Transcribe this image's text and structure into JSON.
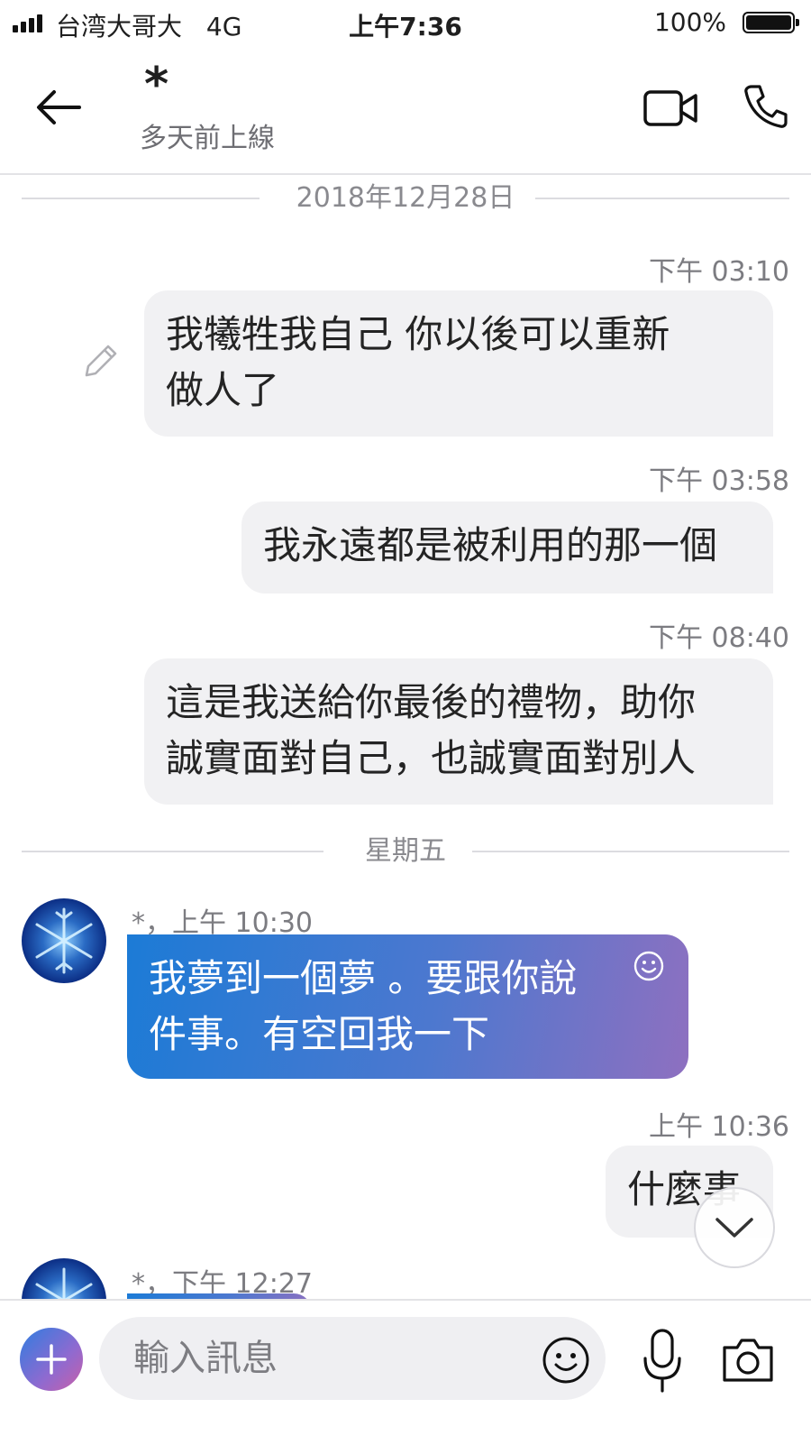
{
  "status_bar": {
    "carrier": "台湾大哥大",
    "network": "4G",
    "time": "上午7:36",
    "battery": "100%"
  },
  "header": {
    "contact_name": "*",
    "contact_status": "多天前上線"
  },
  "separators": {
    "first": "2018年12月28日",
    "second": "星期五"
  },
  "messages": [
    {
      "direction": "outgoing",
      "time": "下午 03:10",
      "lines": [
        "我犧牲我自己  你以後可以重新",
        "做人了"
      ]
    },
    {
      "direction": "outgoing",
      "time": "下午 03:58",
      "lines": [
        "我永遠都是被利用的那一個"
      ]
    },
    {
      "direction": "outgoing",
      "time": "下午 08:40",
      "lines": [
        "這是我送給你最後的禮物，助你",
        "誠實面對自己，也誠實面對別人"
      ]
    },
    {
      "direction": "incoming",
      "meta": "*，上午 10:30",
      "lines": [
        "我夢到一個夢  。要跟你說",
        "件事。有空回我一下"
      ]
    },
    {
      "direction": "outgoing",
      "time": "上午 10:36",
      "lines": [
        "什麼事"
      ]
    },
    {
      "direction": "incoming",
      "meta": "*，下午 12:27",
      "lines": []
    }
  ],
  "composer": {
    "placeholder": "輸入訊息"
  },
  "colors": {
    "outgoing_bubble": "#f1f1f3",
    "incoming_gradient_start": "#1c7bd6",
    "incoming_gradient_end": "#8e70c0",
    "divider": "#e3e3e6"
  },
  "icons": [
    "back-arrow-icon",
    "video-camera-icon",
    "phone-icon",
    "pencil-icon",
    "emoji-icon",
    "chevron-down-icon",
    "plus-icon",
    "microphone-icon",
    "camera-icon"
  ]
}
